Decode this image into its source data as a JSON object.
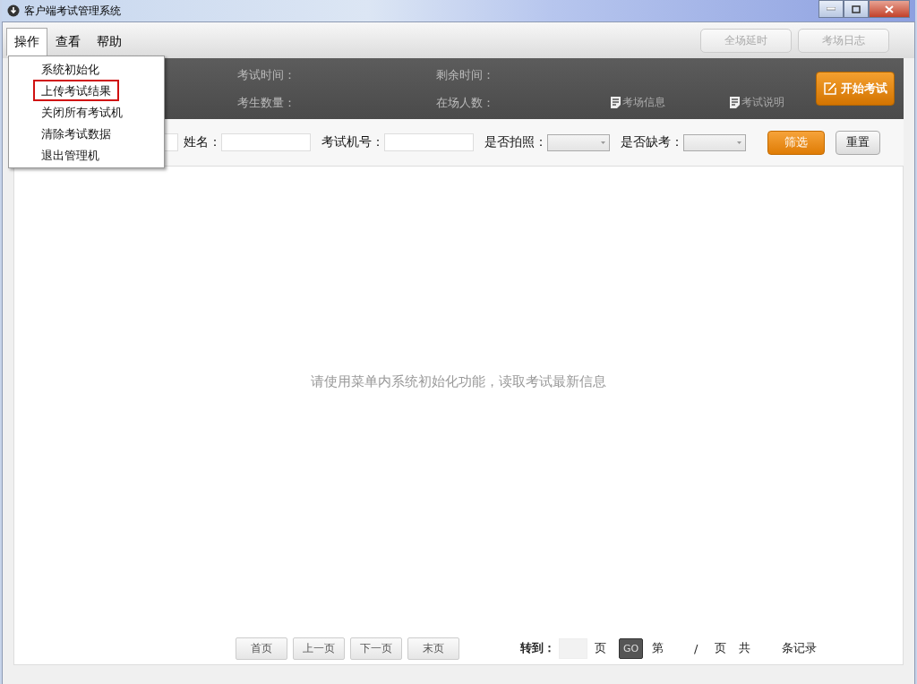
{
  "window": {
    "title": "客户端考试管理系统"
  },
  "menu_bar": [
    {
      "label": "操作",
      "selected": true
    },
    {
      "label": "查看",
      "selected": false
    },
    {
      "label": "帮助",
      "selected": false
    }
  ],
  "toolbar_buttons": [
    {
      "label": "全场延时",
      "disabled": true
    },
    {
      "label": "考场日志",
      "disabled": true
    }
  ],
  "dropdown_menu": [
    {
      "label": "系统初始化",
      "selected": false
    },
    {
      "label": "上传考试结果",
      "selected": true
    },
    {
      "label": "关闭所有考试机",
      "selected": false
    },
    {
      "label": "清除考试数据",
      "selected": false
    },
    {
      "label": "退出管理机",
      "selected": false
    }
  ],
  "info_bar": {
    "fields": [
      {
        "label": "考试时间："
      },
      {
        "label": "剩余时间："
      },
      {
        "label": "考生数量："
      },
      {
        "label": "在场人数："
      }
    ],
    "links": [
      {
        "label": "考场信息"
      },
      {
        "label": "考试说明"
      }
    ],
    "start_button": "开始考试"
  },
  "filters": [
    {
      "kind": "input"
    },
    {
      "kind": "input",
      "label": "姓名："
    },
    {
      "kind": "input",
      "label": "考试机号："
    },
    {
      "kind": "select",
      "label": "是否拍照："
    },
    {
      "kind": "select",
      "label": "是否缺考："
    }
  ],
  "filter_buttons": [
    {
      "label": "筛选",
      "kind": "primary"
    },
    {
      "label": "重置",
      "kind": "default"
    }
  ],
  "empty_message": "请使用菜单内系统初始化功能，读取考试最新信息",
  "pager": {
    "buttons": [
      "首页",
      "上一页",
      "下一页",
      "末页"
    ],
    "goto_label": "转到：",
    "goto_unit": "页",
    "go": "GO",
    "current_prefix": "第",
    "separator": "/",
    "pages_suffix": "页",
    "total_prefix": "共",
    "total_suffix": "条记录"
  }
}
